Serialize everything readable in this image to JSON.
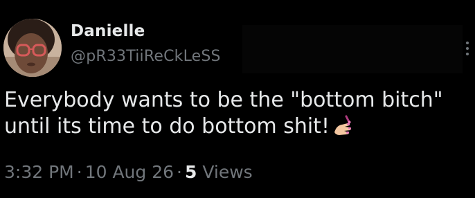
{
  "author": {
    "display_name": "Danielle",
    "handle": "@pR33TiiReCkLeSS"
  },
  "tweet": {
    "line1": "Everybody wants to be the \"bottom bitch\"",
    "line2": "until its time to do bottom shit!",
    "emoji_icon": "nail-polish-icon"
  },
  "meta": {
    "time": "3:32 PM",
    "separator": "·",
    "date": "10 Aug 26",
    "views_count": "5",
    "views_label": "Views"
  },
  "colors": {
    "background": "#000000",
    "primary_text": "#e7e9ea",
    "secondary_text": "#71767b",
    "nail_polish": "#e87ab8"
  }
}
